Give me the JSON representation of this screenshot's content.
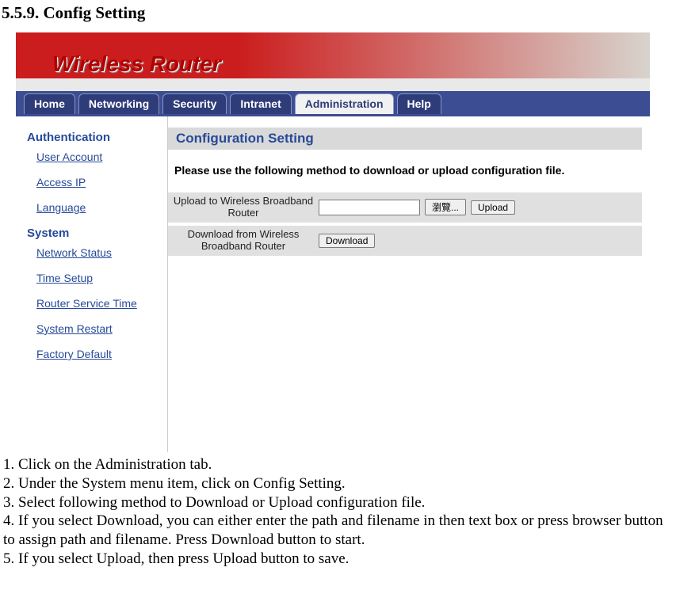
{
  "doc": {
    "heading": "5.5.9. Config Setting",
    "steps": [
      "1. Click on the Administration tab.",
      "2. Under the System menu item, click on Config Setting.",
      "3. Select following method to Download or Upload configuration file.",
      "4. If you select Download, you can either enter the path and filename in then text box or press browser button to assign path and filename. Press Download button to start.",
      "5. If you select Upload, then press Upload button to save."
    ]
  },
  "ui": {
    "banner_title": "Wireless Router",
    "tabs": {
      "home": "Home",
      "networking": "Networking",
      "security": "Security",
      "intranet": "Intranet",
      "administration": "Administration",
      "help": "Help"
    },
    "sidebar": {
      "section1": "Authentication",
      "links1": {
        "user_account": "User Account",
        "access_ip": "Access IP",
        "language": "Language"
      },
      "section2": "System",
      "links2": {
        "network_status": "Network Status",
        "time_setup": "Time Setup",
        "router_service_time": "Router Service Time",
        "system_restart": "System Restart",
        "factory_default": "Factory Default"
      }
    },
    "content": {
      "title": "Configuration Setting",
      "instruction": "Please use the following method to download or upload configuration file.",
      "upload_label": "Upload to Wireless Broadband Router",
      "download_label": "Download from Wireless Broadband Router",
      "browse_btn": "瀏覽...",
      "upload_btn": "Upload",
      "download_btn": "Download",
      "file_value": ""
    }
  }
}
